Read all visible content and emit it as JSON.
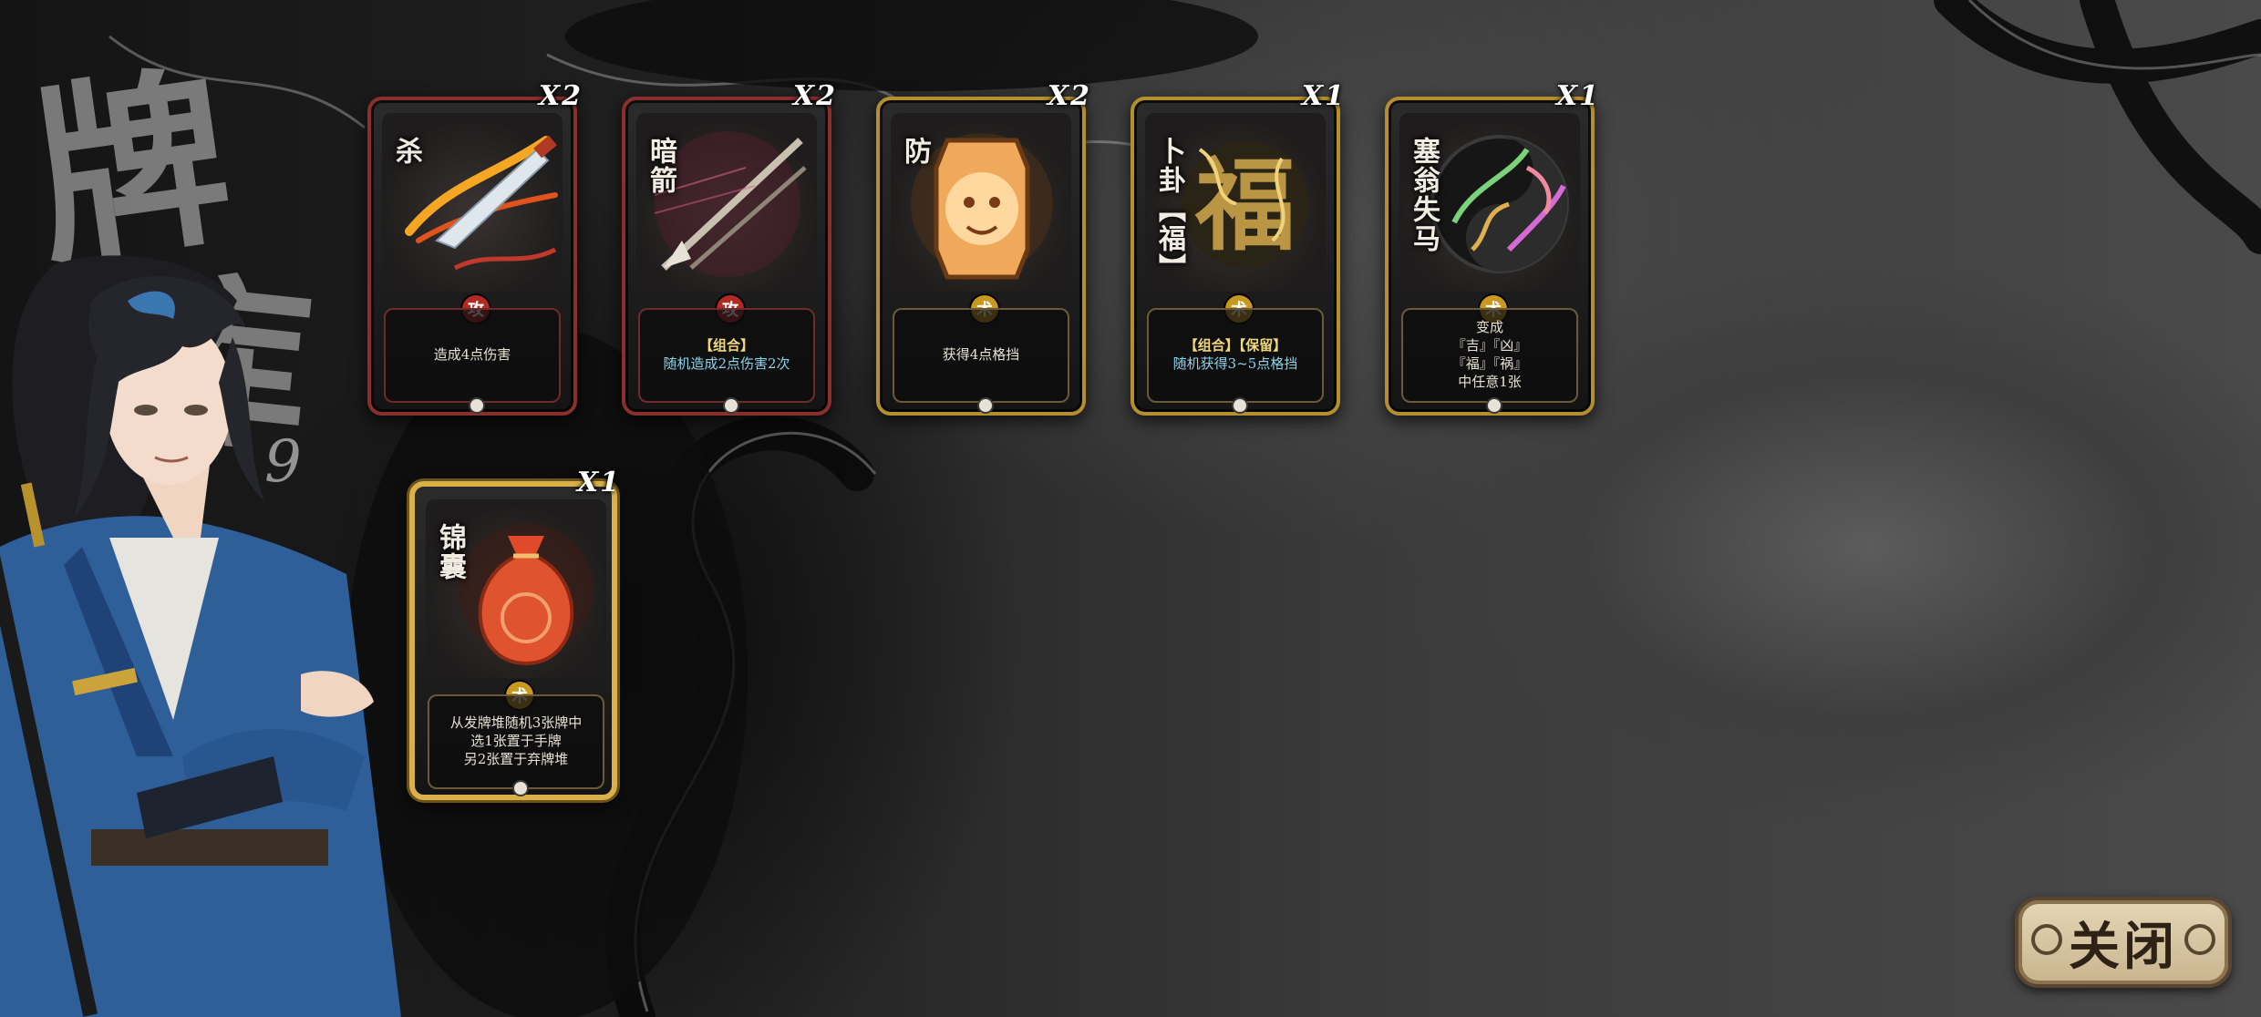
{
  "deck": {
    "title_char_1": "牌",
    "title_char_2": "库",
    "count": "9"
  },
  "cards": [
    {
      "name": "杀",
      "count": "X2",
      "seal": "攻",
      "tags": "",
      "desc": "造成4点伤害",
      "frame": "red",
      "art_icon": "sword-slash-icon"
    },
    {
      "name": "暗箭",
      "count": "X2",
      "seal": "攻",
      "tags": "【组合】",
      "desc": "随机造成2点伤害2次",
      "frame": "red",
      "art_icon": "arrow-icon"
    },
    {
      "name": "防",
      "count": "X2",
      "seal": "术",
      "tags": "",
      "desc": "获得4点格挡",
      "frame": "gold",
      "art_icon": "shield-icon"
    },
    {
      "name": "卜卦【福】",
      "count": "X1",
      "seal": "术",
      "tags": "【组合】【保留】",
      "desc": "随机获得3~5点格挡",
      "frame": "gold",
      "art_icon": "fortune-icon"
    },
    {
      "name": "塞翁失马",
      "count": "X1",
      "seal": "术",
      "tags": "",
      "desc": "变成",
      "desc_lines": [
        "『吉』『凶』",
        "『福』『祸』",
        "中任意1张"
      ],
      "frame": "gold",
      "art_icon": "horse-icon"
    },
    {
      "name": "锦囊",
      "count": "X1",
      "seal": "术",
      "tags": "",
      "desc_lines": [
        "从发牌堆随机3张牌中",
        "选1张置于手牌",
        "另2张置于弃牌堆"
      ],
      "frame": "gold-bright",
      "art_icon": "pouch-icon"
    }
  ],
  "close_button": {
    "label": "关闭"
  },
  "colors": {
    "attack_frame": "#8b2f2c",
    "skill_frame": "#b58f2d",
    "highlight_text": "#8fd3e8",
    "tag_text": "#f0d77a"
  }
}
